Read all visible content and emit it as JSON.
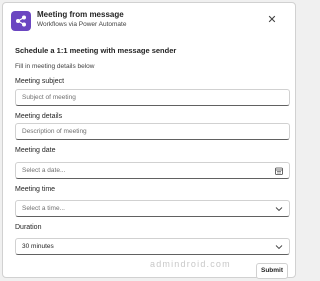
{
  "header": {
    "title": "Meeting from message",
    "subtitle": "Workflows via Power Automate",
    "close_label": "✕",
    "app_icon": "power-automate-workflow-icon",
    "app_icon_color": "#6b46c1"
  },
  "form": {
    "heading": "Schedule a 1:1 meeting with message sender",
    "intro": "Fill in meeting details below",
    "subject": {
      "label": "Meeting subject",
      "placeholder": "Subject of meeting"
    },
    "details": {
      "label": "Meeting details",
      "placeholder": "Description of meeting"
    },
    "date": {
      "label": "Meeting date",
      "placeholder": "Select a date...",
      "icon": "calendar-icon"
    },
    "time": {
      "label": "Meeting time",
      "placeholder": "Select a time...",
      "icon": "chevron-down-icon"
    },
    "duration": {
      "label": "Duration",
      "value": "30 minutes",
      "icon": "chevron-down-icon"
    }
  },
  "footer": {
    "brand": "admindroid.com",
    "submit_label": "Submit"
  }
}
